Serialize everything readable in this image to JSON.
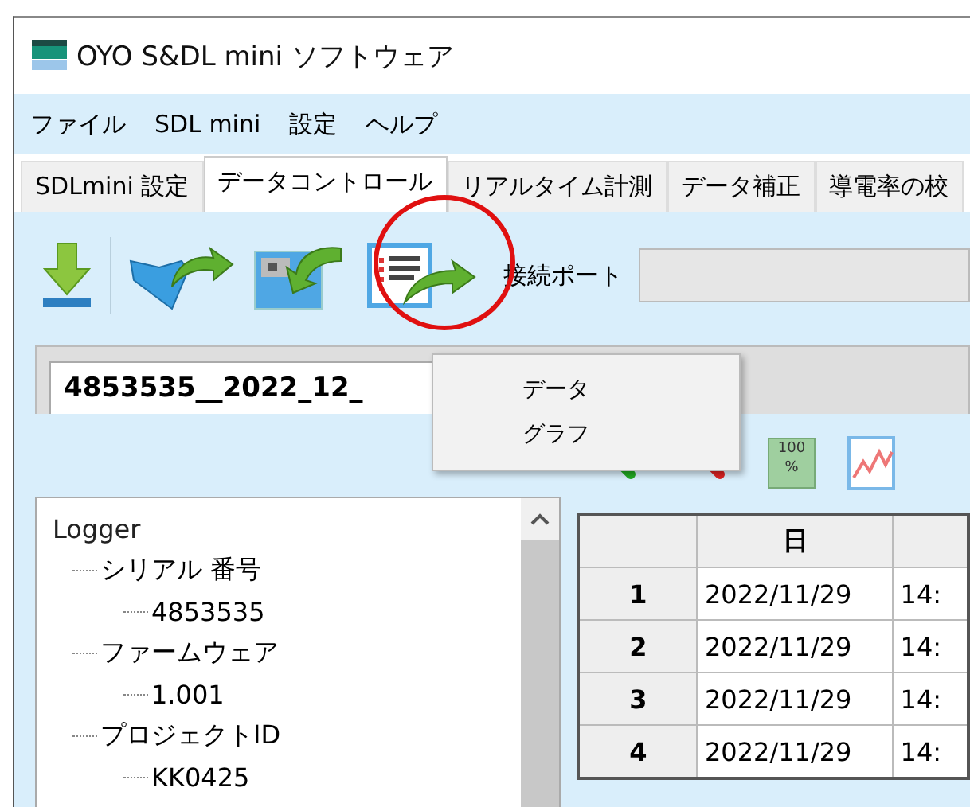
{
  "window": {
    "title": "OYO S&DL mini ソフトウェア"
  },
  "menu": [
    "ファイル",
    "SDL mini",
    "設定",
    "ヘルプ"
  ],
  "tabs": [
    {
      "label": "SDLmini 設定",
      "selected": false
    },
    {
      "label": "データコントロール",
      "selected": true
    },
    {
      "label": "リアルタイム計測",
      "selected": false
    },
    {
      "label": "データ補正",
      "selected": false
    },
    {
      "label": "導電率の校",
      "selected": false
    }
  ],
  "toolbar": {
    "port_label": "接続ポート"
  },
  "popup_menu": [
    "データ",
    "グラフ"
  ],
  "document_tab": {
    "label": "4853535__2022_12_"
  },
  "view_toolbar": {
    "zoom_label": "100",
    "zoom_unit": "%"
  },
  "tree": {
    "label": "Logger",
    "children": [
      {
        "label": "シリアル 番号",
        "children": [
          {
            "label": "4853535"
          }
        ]
      },
      {
        "label": "ファームウェア",
        "children": [
          {
            "label": "1.001"
          }
        ]
      },
      {
        "label": "プロジェクトID",
        "children": [
          {
            "label": "KK0425"
          }
        ]
      }
    ]
  },
  "table": {
    "columns": [
      "",
      "日",
      ""
    ],
    "rows": [
      [
        "1",
        "2022/11/29",
        "14:"
      ],
      [
        "2",
        "2022/11/29",
        "14:"
      ],
      [
        "3",
        "2022/11/29",
        "14:"
      ],
      [
        "4",
        "2022/11/29",
        "14:"
      ]
    ]
  }
}
